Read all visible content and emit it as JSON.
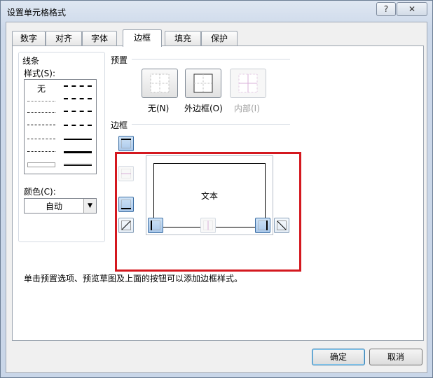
{
  "window": {
    "title": "设置单元格格式",
    "help": "?",
    "close": "✕"
  },
  "tabs": [
    {
      "label": "数字"
    },
    {
      "label": "对齐"
    },
    {
      "label": "字体"
    },
    {
      "label": "边框",
      "active": true
    },
    {
      "label": "填充"
    },
    {
      "label": "保护"
    }
  ],
  "line": {
    "group_label": "线条",
    "style_label": "样式(S):",
    "none_label": "无",
    "color_label": "颜色(C):",
    "color_value": "自动",
    "styles_left": [
      "none",
      "dotted-hair",
      "dotted",
      "dash-dot-dot",
      "dash-dot",
      "dashed-thin",
      "double-thin"
    ],
    "styles_right": [
      "dash-dot-dot-medium",
      "slant-dash-dot",
      "dash-dot-medium",
      "dashed-medium",
      "medium",
      "thick",
      "double"
    ],
    "selected_style": "none"
  },
  "presets": {
    "label": "预置",
    "items": [
      {
        "label": "无(N)",
        "enabled": true
      },
      {
        "label": "外边框(O)",
        "enabled": true
      },
      {
        "label": "内部(I)",
        "enabled": false
      }
    ]
  },
  "border": {
    "label": "边框",
    "preview_text": "文本",
    "left_buttons": [
      {
        "name": "top-border",
        "on": true
      },
      {
        "name": "inside-horizontal-border",
        "on": false,
        "enabled": false
      },
      {
        "name": "bottom-border",
        "on": true
      },
      {
        "name": "diagonal-up-border",
        "on": false
      }
    ],
    "bottom_buttons": [
      {
        "name": "left-border",
        "on": true
      },
      {
        "name": "inside-vertical-border",
        "on": false,
        "enabled": false
      },
      {
        "name": "right-border",
        "on": true
      },
      {
        "name": "diagonal-down-border",
        "on": false
      }
    ]
  },
  "hint": "单击预置选项、预览草图及上面的按钮可以添加边框样式。",
  "footer": {
    "ok": "确定",
    "cancel": "取消"
  },
  "colors": {
    "highlight_box": "#d4181f",
    "window_frame": "#c9d6e8",
    "panel": "#ffffff"
  }
}
